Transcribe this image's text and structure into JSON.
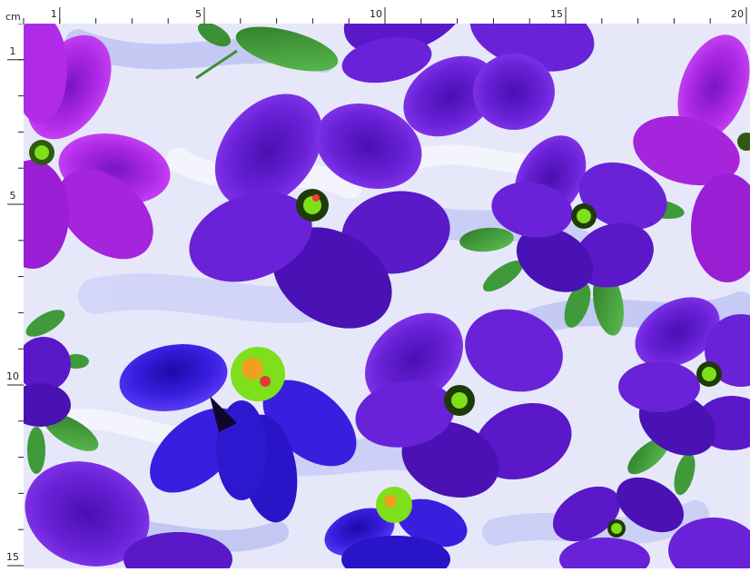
{
  "ruler": {
    "unit": "cm",
    "top_labels": [
      {
        "cm": 1,
        "label": "1"
      },
      {
        "cm": 5,
        "label": "5"
      },
      {
        "cm": 10,
        "label": "10"
      },
      {
        "cm": 15,
        "label": "15"
      },
      {
        "cm": 20,
        "label": "20"
      }
    ],
    "left_labels": [
      {
        "cm": 1,
        "label": "1"
      },
      {
        "cm": 5,
        "label": "5"
      },
      {
        "cm": 10,
        "label": "10"
      },
      {
        "cm": 15,
        "label": "15"
      }
    ]
  },
  "pattern": {
    "colors": {
      "background": "#dcdff7",
      "violet": "#6a1fd6",
      "magenta": "#a724e0",
      "blue": "#3b1bde",
      "leaf": "#3f9a3a",
      "center": "#7de01a"
    }
  }
}
